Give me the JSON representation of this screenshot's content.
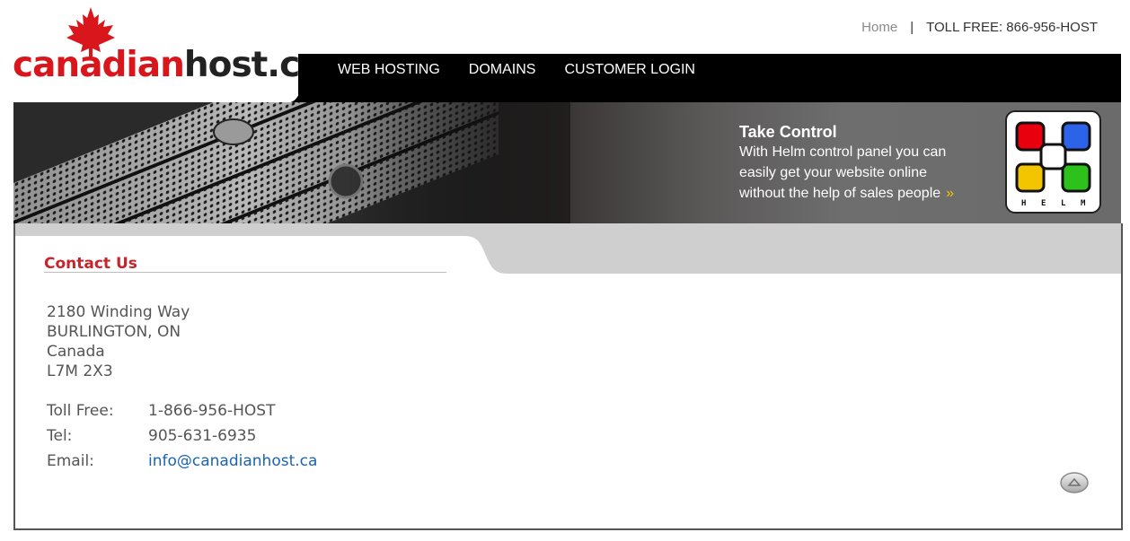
{
  "header": {
    "home_link": "Home",
    "separator": "|",
    "toll_free": "TOLL FREE: 866-956-HOST"
  },
  "logo": {
    "text_part1": "canadian",
    "text_part2": "host.ca",
    "icon": "maple-leaf-icon"
  },
  "nav": {
    "items": [
      {
        "label": "WEB HOSTING"
      },
      {
        "label": "DOMAINS"
      },
      {
        "label": "CUSTOMER LOGIN"
      }
    ]
  },
  "banner": {
    "promo_title": "Take Control",
    "promo_lines": [
      "With Helm control panel you can",
      "easily get your website online",
      "without the help of sales people"
    ],
    "promo_arrow": "»",
    "helm_letters": [
      "H",
      "E",
      "L",
      "M"
    ]
  },
  "contact": {
    "title": "Contact Us",
    "address": [
      "2180 Winding Way",
      "BURLINGTON, ON",
      "Canada",
      "L7M 2X3"
    ],
    "rows": [
      {
        "label": "Toll Free:",
        "value": "1-866-956-HOST"
      },
      {
        "label": "Tel:",
        "value": "905-631-6935"
      },
      {
        "label": "Email:",
        "value": "info@canadianhost.ca"
      }
    ]
  },
  "colors": {
    "brand_red": "#d9161b",
    "title_red": "#c8242b",
    "link_blue": "#1a63b5",
    "nav_bg": "#000000"
  },
  "icons": {
    "top_button": "scroll-to-top-icon"
  }
}
